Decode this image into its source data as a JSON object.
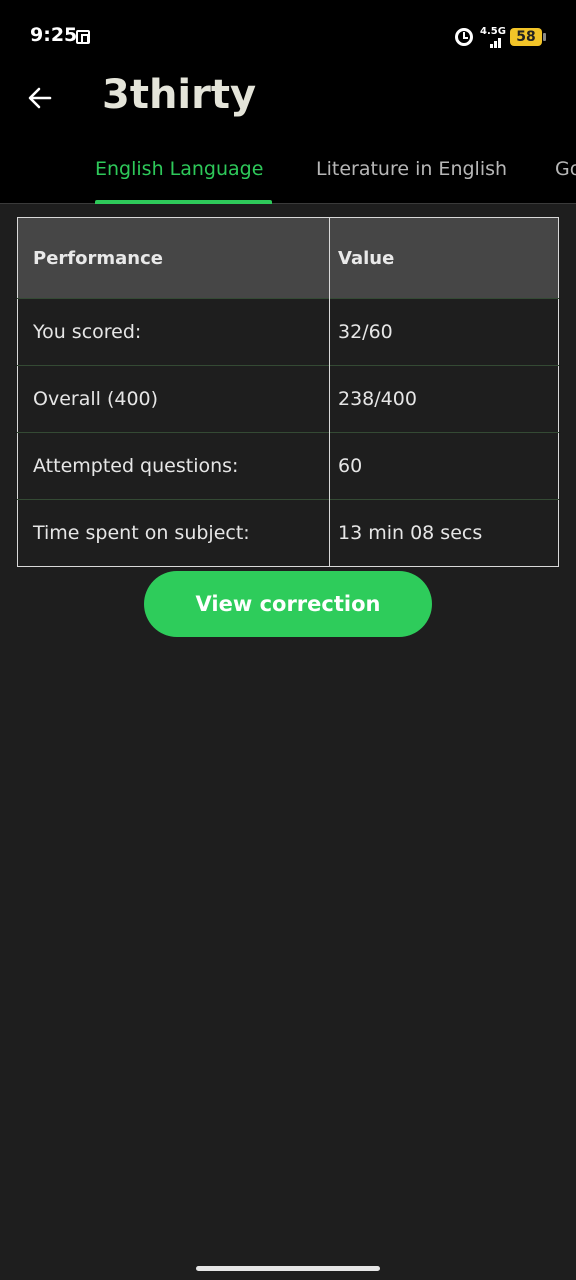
{
  "status_bar": {
    "time": "9:25",
    "network": "4.5G",
    "battery": "58"
  },
  "header": {
    "title": "3thirty"
  },
  "tabs": [
    {
      "label": "English Language",
      "active": true
    },
    {
      "label": "Literature in English",
      "active": false
    },
    {
      "label": "Go",
      "active": false
    }
  ],
  "table": {
    "headers": [
      "Performance",
      "Value"
    ],
    "rows": [
      {
        "label": "You scored:",
        "value": "32/60"
      },
      {
        "label": "Overall (400)",
        "value": "238/400"
      },
      {
        "label": "Attempted questions:",
        "value": "60"
      },
      {
        "label": "Time spent on subject:",
        "value": "13 min 08 secs"
      }
    ]
  },
  "actions": {
    "view_correction": "View correction"
  },
  "colors": {
    "accent": "#2ecc5b",
    "background": "#1e1e1e",
    "header_background": "#000000"
  }
}
